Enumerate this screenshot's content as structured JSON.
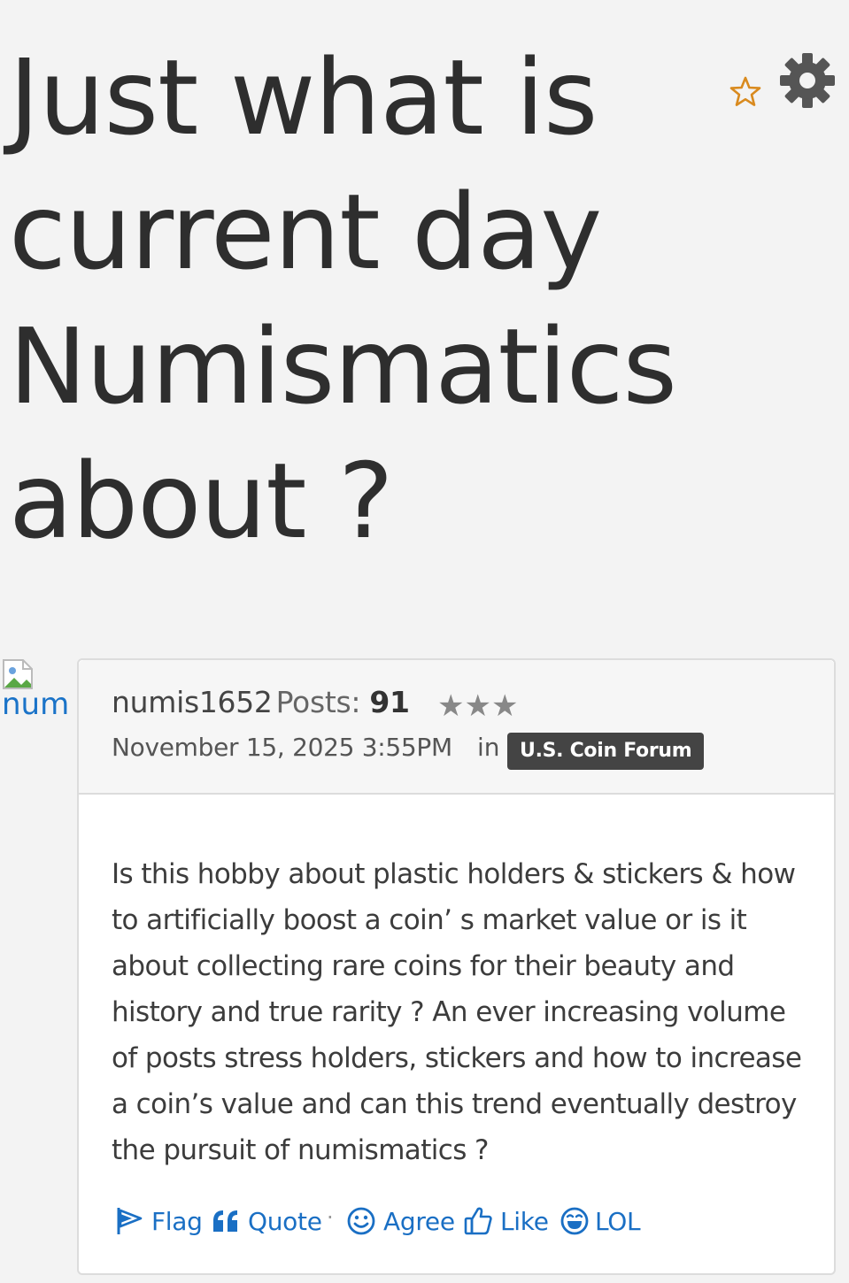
{
  "discussion": {
    "title": "Just what is current day Numismatics about ?"
  },
  "avatar": {
    "alt": "num"
  },
  "post": {
    "author": "numis1652",
    "posts_label": "Posts:",
    "posts_count": "91",
    "rank_stars": "★★★",
    "datetime": "November 15, 2025 3:55PM",
    "in_label": "in",
    "category": "U.S. Coin Forum",
    "body": "Is this hobby about plastic holders & stickers & how to artificially boost a coin’ s market value or is it about collecting rare coins for their beauty and history and true rarity ? An ever increasing volume of posts stress holders, stickers and how to increase a coin’s value and can this trend eventually destroy the pursuit of numismatics ?"
  },
  "reactions": {
    "flag": "Flag",
    "quote": "Quote",
    "separator": "·",
    "agree": "Agree",
    "like": "Like",
    "lol": "LOL"
  },
  "colors": {
    "link": "#1a6fc4",
    "bookmark": "#d98a1e",
    "tag_bg": "#444444"
  },
  "icons": [
    "bookmark-star-icon",
    "gear-icon",
    "broken-image-icon",
    "flag-icon",
    "quote-icon",
    "smile-icon",
    "thumbs-up-icon",
    "laugh-icon"
  ]
}
